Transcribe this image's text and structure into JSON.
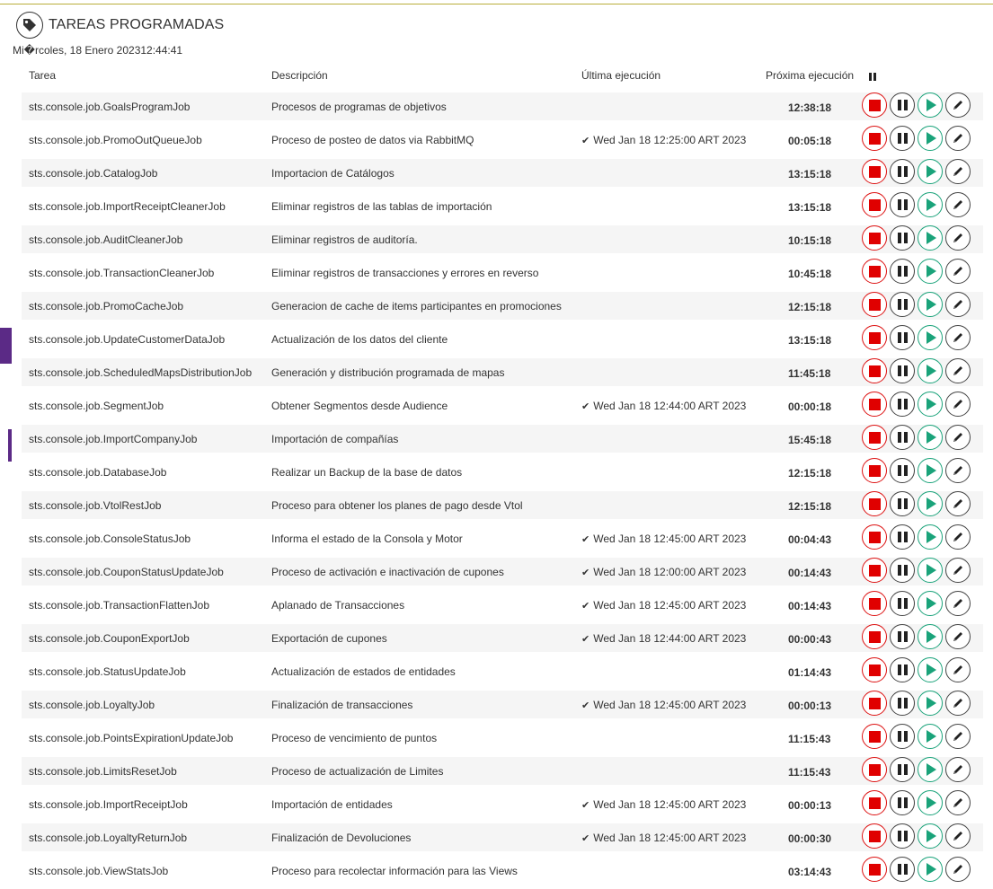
{
  "header": {
    "title": "TAREAS PROGRAMADAS"
  },
  "datetime": "Mi�rcoles, 18 Enero 202312:44:41",
  "columns": {
    "task": "Tarea",
    "description": "Descripción",
    "last": "Última ejecución",
    "next": "Próxima ejecución"
  },
  "icons": {
    "header": "tag-icon",
    "stop": "stop-icon",
    "pause": "pause-icon",
    "play": "play-icon",
    "edit": "pencil-icon"
  },
  "colors": {
    "stop": "#e00000",
    "play": "#1aa37a",
    "accent": "#5b2a86"
  },
  "rows": [
    {
      "task": "sts.console.job.GoalsProgramJob",
      "description": "Procesos de programas de objetivos",
      "last": "",
      "next": "12:38:18"
    },
    {
      "task": "sts.console.job.PromoOutQueueJob",
      "description": "Proceso de posteo de datos via RabbitMQ",
      "last": "Wed Jan 18 12:25:00 ART 2023",
      "next": "00:05:18"
    },
    {
      "task": "sts.console.job.CatalogJob",
      "description": "Importacion de Catálogos",
      "last": "",
      "next": "13:15:18"
    },
    {
      "task": "sts.console.job.ImportReceiptCleanerJob",
      "description": "Eliminar registros de las tablas de importación",
      "last": "",
      "next": "13:15:18"
    },
    {
      "task": "sts.console.job.AuditCleanerJob",
      "description": "Eliminar registros de auditoría.",
      "last": "",
      "next": "10:15:18"
    },
    {
      "task": "sts.console.job.TransactionCleanerJob",
      "description": "Eliminar registros de transacciones y errores en reverso",
      "last": "",
      "next": "10:45:18"
    },
    {
      "task": "sts.console.job.PromoCacheJob",
      "description": "Generacion de cache de items participantes en promociones",
      "last": "",
      "next": "12:15:18"
    },
    {
      "task": "sts.console.job.UpdateCustomerDataJob",
      "description": "Actualización de los datos del cliente",
      "last": "",
      "next": "13:15:18"
    },
    {
      "task": "sts.console.job.ScheduledMapsDistributionJob",
      "description": "Generación y distribución programada de mapas",
      "last": "",
      "next": "11:45:18"
    },
    {
      "task": "sts.console.job.SegmentJob",
      "description": "Obtener Segmentos desde Audience",
      "last": "Wed Jan 18 12:44:00 ART 2023",
      "next": "00:00:18"
    },
    {
      "task": "sts.console.job.ImportCompanyJob",
      "description": "Importación de compañías",
      "last": "",
      "next": "15:45:18"
    },
    {
      "task": "sts.console.job.DatabaseJob",
      "description": "Realizar un Backup de la base de datos",
      "last": "",
      "next": "12:15:18"
    },
    {
      "task": "sts.console.job.VtolRestJob",
      "description": "Proceso para obtener los planes de pago desde Vtol",
      "last": "",
      "next": "12:15:18"
    },
    {
      "task": "sts.console.job.ConsoleStatusJob",
      "description": "Informa el estado de la Consola y Motor",
      "last": "Wed Jan 18 12:45:00 ART 2023",
      "next": "00:04:43"
    },
    {
      "task": "sts.console.job.CouponStatusUpdateJob",
      "description": "Proceso de activación e inactivación de cupones",
      "last": "Wed Jan 18 12:00:00 ART 2023",
      "next": "00:14:43"
    },
    {
      "task": "sts.console.job.TransactionFlattenJob",
      "description": "Aplanado de Transacciones",
      "last": "Wed Jan 18 12:45:00 ART 2023",
      "next": "00:14:43"
    },
    {
      "task": "sts.console.job.CouponExportJob",
      "description": "Exportación de cupones",
      "last": "Wed Jan 18 12:44:00 ART 2023",
      "next": "00:00:43"
    },
    {
      "task": "sts.console.job.StatusUpdateJob",
      "description": "Actualización de estados de entidades",
      "last": "",
      "next": "01:14:43"
    },
    {
      "task": "sts.console.job.LoyaltyJob",
      "description": "Finalización de transacciones",
      "last": "Wed Jan 18 12:45:00 ART 2023",
      "next": "00:00:13"
    },
    {
      "task": "sts.console.job.PointsExpirationUpdateJob",
      "description": "Proceso de vencimiento de puntos",
      "last": "",
      "next": "11:15:43"
    },
    {
      "task": "sts.console.job.LimitsResetJob",
      "description": "Proceso de actualización de Limites",
      "last": "",
      "next": "11:15:43"
    },
    {
      "task": "sts.console.job.ImportReceiptJob",
      "description": "Importación de entidades",
      "last": "Wed Jan 18 12:45:00 ART 2023",
      "next": "00:00:13"
    },
    {
      "task": "sts.console.job.LoyaltyReturnJob",
      "description": "Finalización de Devoluciones",
      "last": "Wed Jan 18 12:45:00 ART 2023",
      "next": "00:00:30"
    },
    {
      "task": "sts.console.job.ViewStatsJob",
      "description": "Proceso para recolectar información para las Views",
      "last": "",
      "next": "03:14:43"
    }
  ]
}
